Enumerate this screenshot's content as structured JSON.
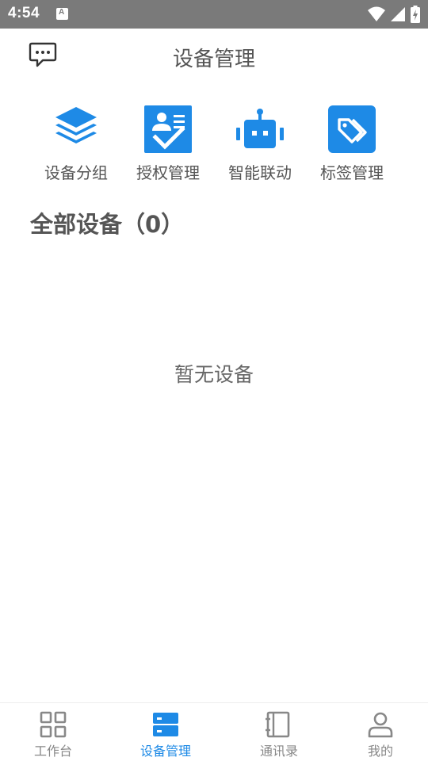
{
  "status_bar": {
    "time": "4:54"
  },
  "header": {
    "title": "设备管理"
  },
  "actions": [
    {
      "id": "group",
      "label": "设备分组",
      "icon": "layers-icon"
    },
    {
      "id": "auth",
      "label": "授权管理",
      "icon": "authorization-card-icon"
    },
    {
      "id": "smart",
      "label": "智能联动",
      "icon": "robot-icon"
    },
    {
      "id": "tags",
      "label": "标签管理",
      "icon": "tags-icon"
    }
  ],
  "section": {
    "title": "全部设备（0）"
  },
  "empty_state": {
    "text": "暂无设备"
  },
  "bottom_nav": {
    "active": 1,
    "items": [
      {
        "label": "工作台",
        "icon": "grid-icon"
      },
      {
        "label": "设备管理",
        "icon": "server-icon"
      },
      {
        "label": "通讯录",
        "icon": "contacts-book-icon"
      },
      {
        "label": "我的",
        "icon": "user-icon"
      }
    ]
  },
  "colors": {
    "accent": "#1e8ae6",
    "text": "#555555",
    "nav_inactive": "#888888",
    "status_bar": "#7a7a7a"
  }
}
